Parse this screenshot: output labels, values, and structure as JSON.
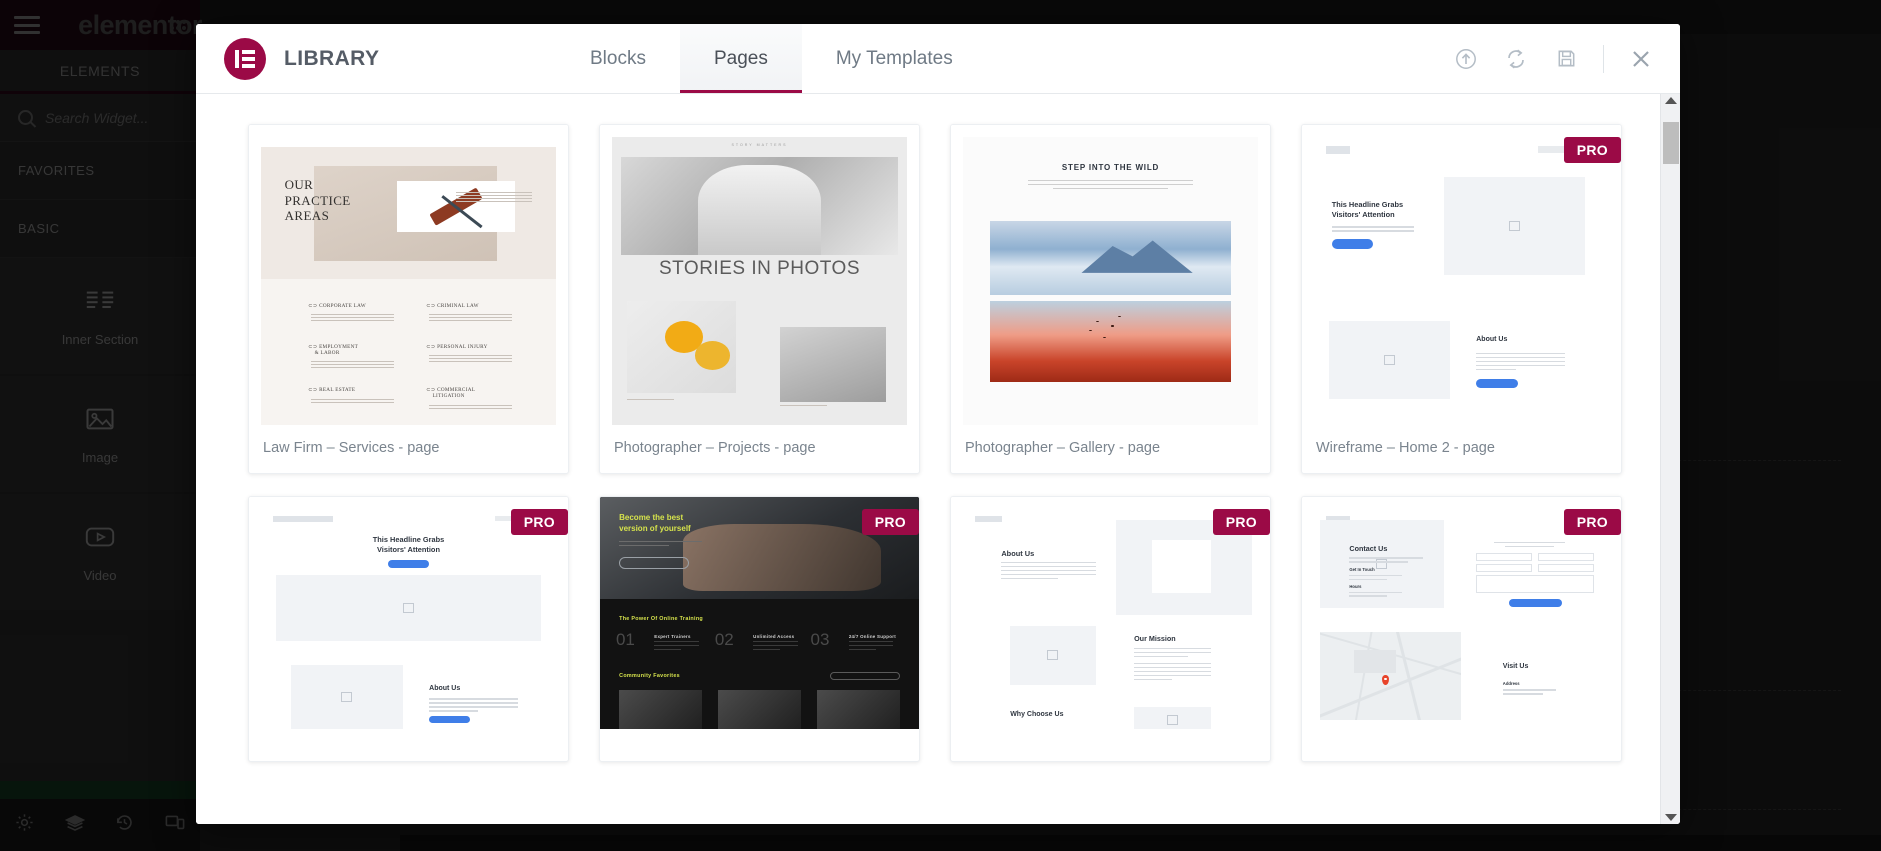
{
  "editor": {
    "brand": "elementor",
    "panel_tab": "ELEMENTS",
    "search_placeholder": "Search Widget...",
    "categories": [
      {
        "label": "FAVORITES"
      },
      {
        "label": "BASIC"
      }
    ],
    "widgets": [
      {
        "label": "Inner Section",
        "icon": "columns-icon"
      },
      {
        "label": "Image",
        "icon": "image-icon"
      },
      {
        "label": "Video",
        "icon": "video-icon"
      }
    ],
    "bottom_bar": [
      {
        "icon": "gear-icon",
        "name": "settings"
      },
      {
        "icon": "layers-icon",
        "name": "navigator"
      },
      {
        "icon": "history-icon",
        "name": "history"
      },
      {
        "icon": "responsive-icon",
        "name": "responsive-mode"
      }
    ]
  },
  "modal": {
    "title": "LIBRARY",
    "logo_icon": "elementor-logo-icon",
    "tabs": [
      {
        "label": "Blocks",
        "active": false
      },
      {
        "label": "Pages",
        "active": true
      },
      {
        "label": "My Templates",
        "active": false
      }
    ],
    "actions": [
      {
        "icon": "upload-icon",
        "name": "import-template"
      },
      {
        "icon": "sync-icon",
        "name": "sync-library"
      },
      {
        "icon": "save-icon",
        "name": "save-template"
      },
      {
        "icon": "close-icon",
        "name": "close-modal"
      }
    ],
    "scrollbar": {
      "position": "near-top"
    }
  },
  "templates": [
    {
      "name": "Law Firm – Services - page",
      "pro": false,
      "thumb": "law-firm",
      "thumb_text": {
        "title": "OUR\nPRACTICE\nAREAS",
        "items": [
          "CORPORATE LAW",
          "CRIMINAL LAW",
          "EMPLOYMENT\n& LABOR",
          "PERSONAL INJURY",
          "REAL ESTATE",
          "COMMERCIAL\nLITIGATION"
        ]
      }
    },
    {
      "name": "Photographer – Projects - page",
      "pro": false,
      "thumb": "photographer-projects",
      "thumb_text": {
        "eyebrow": "STORY MATTERS",
        "headline": "STORIES IN PHOTOS"
      }
    },
    {
      "name": "Photographer – Gallery - page",
      "pro": false,
      "thumb": "photographer-gallery",
      "thumb_text": {
        "headline": "STEP INTO THE WILD"
      }
    },
    {
      "name": "Wireframe – Home 2 - page",
      "pro": true,
      "thumb": "wireframe-home2",
      "thumb_text": {
        "headline": "This Headline Grabs\nVisitors' Attention",
        "section": "About Us"
      }
    },
    {
      "name": "",
      "pro": true,
      "thumb": "wireframe-home-centered",
      "thumb_text": {
        "headline": "This Headline Grabs\nVisitors' Attention",
        "section": "About Us"
      }
    },
    {
      "name": "",
      "pro": true,
      "thumb": "fitness",
      "thumb_text": {
        "headline": "Become the best\nversion of yourself",
        "section": "The Power Of Online Training",
        "features": [
          {
            "num": "01",
            "label": "Expert Trainers"
          },
          {
            "num": "02",
            "label": "Unlimited Access"
          },
          {
            "num": "03",
            "label": "24/7 Online Support"
          }
        ],
        "section2": "Community Favorites"
      }
    },
    {
      "name": "",
      "pro": true,
      "thumb": "wireframe-about",
      "thumb_text": {
        "headline": "About Us",
        "section": "Our Mission",
        "section2": "Why Choose Us"
      }
    },
    {
      "name": "",
      "pro": true,
      "thumb": "wireframe-contact",
      "thumb_text": {
        "headline": "Contact Us",
        "section": "Visit Us"
      }
    }
  ],
  "colors": {
    "brand": "#9b0a46",
    "panel_bg": "#383838",
    "canvas_bg": "#2e2e2e",
    "modal_bg": "#ffffff",
    "tab_text": "#6f7a85",
    "card_label": "#7a848e",
    "wireframe_blue": "#3f7ee8",
    "fitness_accent": "#d6e34c"
  }
}
